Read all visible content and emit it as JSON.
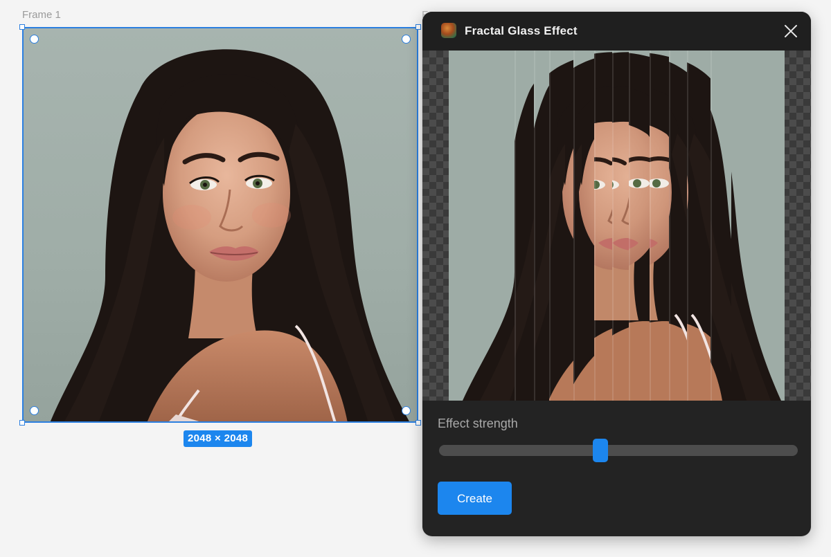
{
  "canvas": {
    "frame_label": "Frame 1",
    "frame2_label_partial": "F",
    "size_badge": "2048 × 2048",
    "selection_color": "#2b7fe0"
  },
  "plugin": {
    "title": "Fractal Glass Effect",
    "icon": "plugin-logo-icon",
    "close_icon": "close-icon",
    "effect_strength_label": "Effect strength",
    "effect_strength_value": 0.45,
    "create_label": "Create",
    "accent_color": "#1c86ee",
    "panel_bg": "#232323"
  }
}
